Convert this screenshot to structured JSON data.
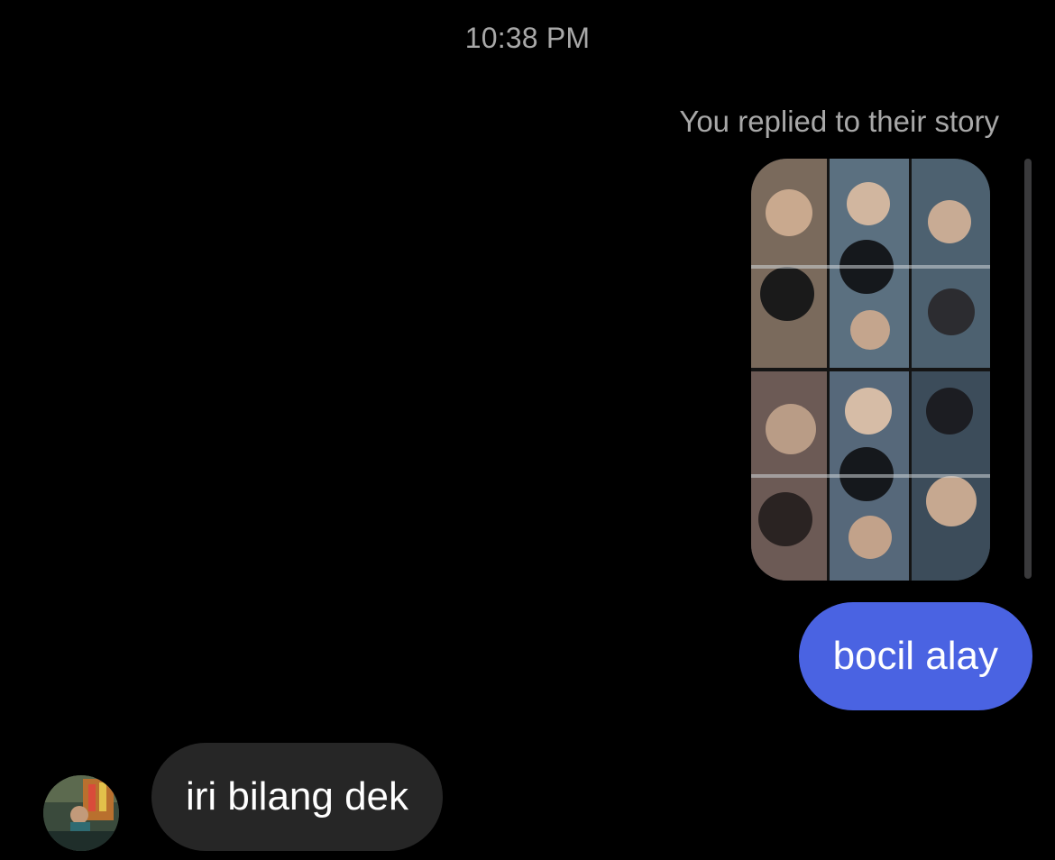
{
  "thread": {
    "timestamp": "10:38 PM",
    "story_reply_note": "You replied to their story",
    "story_thumbnail": {
      "icon": "story-photo-grid",
      "description_colors": [
        "#1d2a36",
        "#6b7e8c",
        "#c9b9a6",
        "#2f3b46"
      ]
    },
    "messages": [
      {
        "direction": "outgoing",
        "text": "bocil alay",
        "color": "#4a63e2"
      },
      {
        "direction": "incoming",
        "text": "iri bilang dek",
        "color": "#262626"
      }
    ],
    "contact_avatar": {
      "icon": "contact-avatar"
    }
  }
}
